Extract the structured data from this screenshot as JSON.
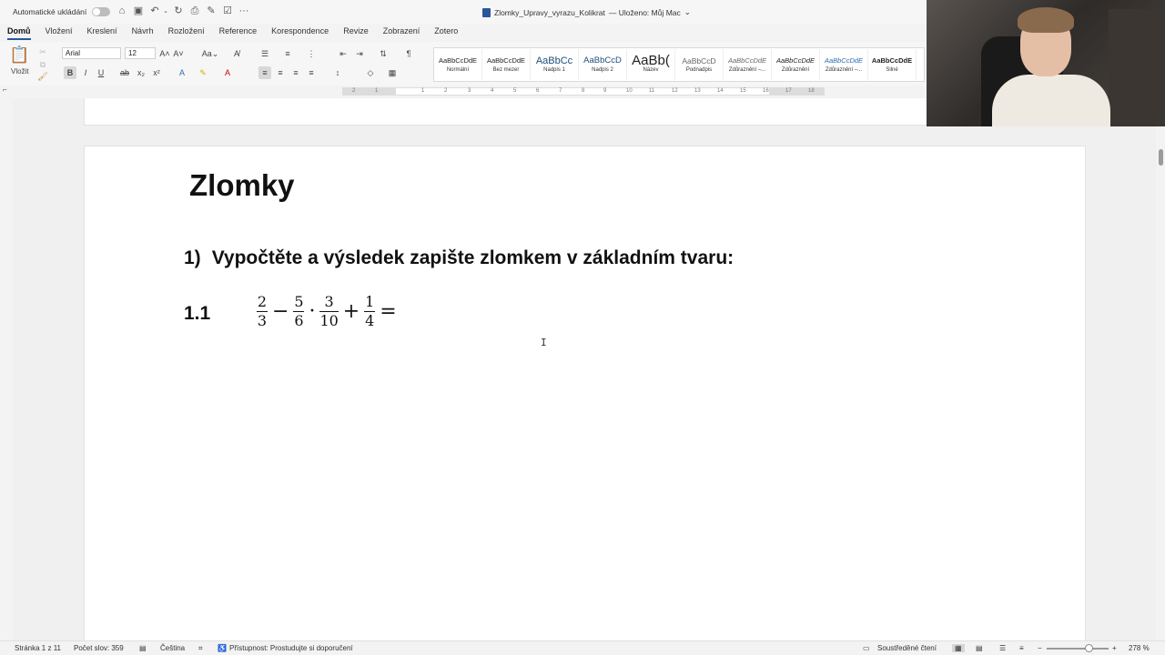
{
  "titlebar": {
    "autosave_label": "Automatické ukládání",
    "document_title": "Zlomky_Upravy_vyrazu_Kolikrat",
    "saved_status": "— Uloženo: Můj Mac",
    "quick_icons": [
      "home-icon",
      "save-icon",
      "undo-icon",
      "redo-icon",
      "print-icon",
      "draw-icon",
      "form-icon",
      "more-icon"
    ]
  },
  "tabs": [
    "Domů",
    "Vložení",
    "Kreslení",
    "Návrh",
    "Rozložení",
    "Reference",
    "Korespondence",
    "Revize",
    "Zobrazení",
    "Zotero"
  ],
  "ribbon": {
    "paste_label": "Vložit",
    "font_name": "Arial",
    "font_size": "12",
    "styles": [
      {
        "sample": "AaBbCcDdE",
        "name": "Normální"
      },
      {
        "sample": "AaBbCcDdE",
        "name": "Bez mezer"
      },
      {
        "sample": "AaBbCc",
        "name": "Nadpis 1"
      },
      {
        "sample": "AaBbCcD",
        "name": "Nadpis 2"
      },
      {
        "sample": "AaBb(",
        "name": "Název"
      },
      {
        "sample": "AaBbCcD",
        "name": "Podnadpis"
      },
      {
        "sample": "AaBbCcDdE",
        "name": "Zdůraznění –..."
      },
      {
        "sample": "AaBbCcDdE",
        "name": "Zdůraznění"
      },
      {
        "sample": "AaBbCcDdE",
        "name": "Zdůraznění –..."
      },
      {
        "sample": "AaBbCcDdE",
        "name": "Silné"
      }
    ]
  },
  "ruler": {
    "numbers": [
      "2",
      "1",
      "1",
      "2",
      "3",
      "4",
      "5",
      "6",
      "7",
      "8",
      "9",
      "10",
      "11",
      "12",
      "13",
      "14",
      "15",
      "16",
      "17",
      "18"
    ]
  },
  "document": {
    "heading": "Zlomky",
    "task_number": "1)",
    "task_text": "Vypočtěte a výsledek zapište zlomkem v základním tvaru:",
    "exercise_number": "1.1",
    "expression": {
      "f1_num": "2",
      "f1_den": "3",
      "op1": "−",
      "f2_num": "5",
      "f2_den": "6",
      "op2": "·",
      "f3_num": "3",
      "f3_den": "10",
      "op3": "+",
      "f4_num": "1",
      "f4_den": "4",
      "op4": "="
    }
  },
  "statusbar": {
    "page": "Stránka 1 z 11",
    "words": "Počet slov: 359",
    "language": "Čeština",
    "accessibility": "Přístupnost: Prostudujte si doporučení",
    "focus": "Soustředěné čtení",
    "zoom": "278 %"
  }
}
